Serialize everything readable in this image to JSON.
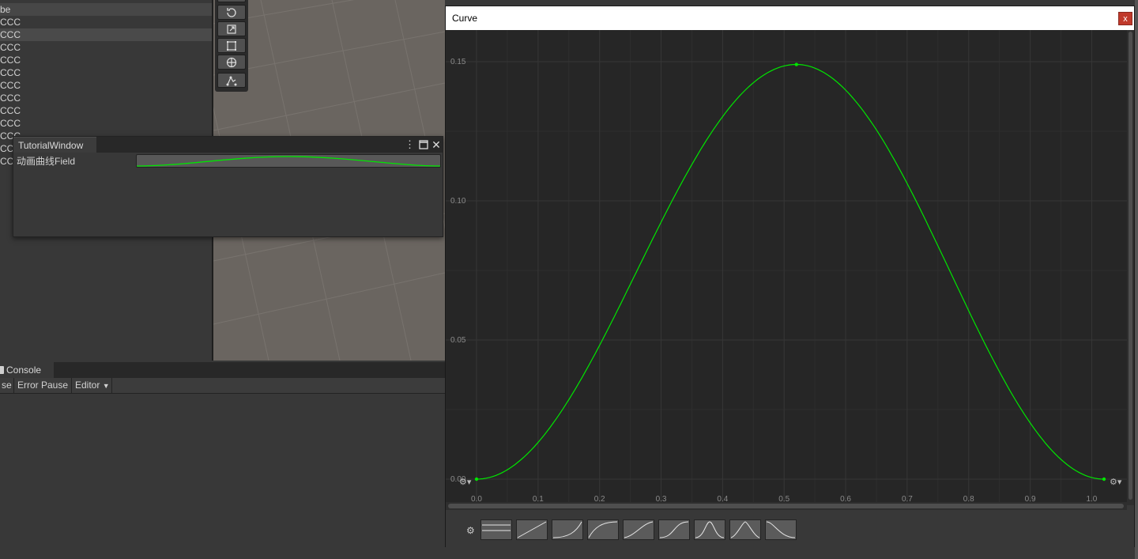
{
  "hierarchy": {
    "items": [
      "be",
      "CCC",
      "CCC",
      "CCC",
      "CCC",
      "CCC",
      "CCC",
      "CCC",
      "CCC",
      "CCC",
      "CCC",
      "CCC",
      "CCC"
    ]
  },
  "tutorial_window": {
    "title": "TutorialWindow",
    "field_label": "动画曲线Field",
    "menu_icon": "⋮",
    "close_icon": "✕"
  },
  "console": {
    "tab_label": "Console",
    "toolbar": {
      "clear_partial": "se",
      "error_pause": "Error Pause",
      "editor": "Editor"
    }
  },
  "curve_window": {
    "title": "Curve",
    "close_label": "x",
    "y_ticks": [
      "0.15",
      "0.10",
      "0.05",
      "0.00"
    ],
    "x_ticks": [
      "0.0",
      "0.1",
      "0.2",
      "0.3",
      "0.4",
      "0.5",
      "0.6",
      "0.7",
      "0.8",
      "0.9",
      "1.0"
    ],
    "presets": [
      "flat",
      "linear",
      "ease-in",
      "ease-out",
      "ease-in-out-soft",
      "ease-in-out",
      "bell",
      "bell-sharp",
      "ease-out-fall"
    ],
    "curve_color": "#00e600"
  },
  "chart_data": {
    "type": "line",
    "title": "Curve",
    "series": [
      {
        "x": [
          0.0,
          0.52,
          1.02
        ],
        "y": [
          0.0,
          0.149,
          0.0
        ]
      }
    ],
    "xlim": [
      0.0,
      1.02
    ],
    "ylim": [
      0.0,
      0.15
    ],
    "grid": true
  }
}
